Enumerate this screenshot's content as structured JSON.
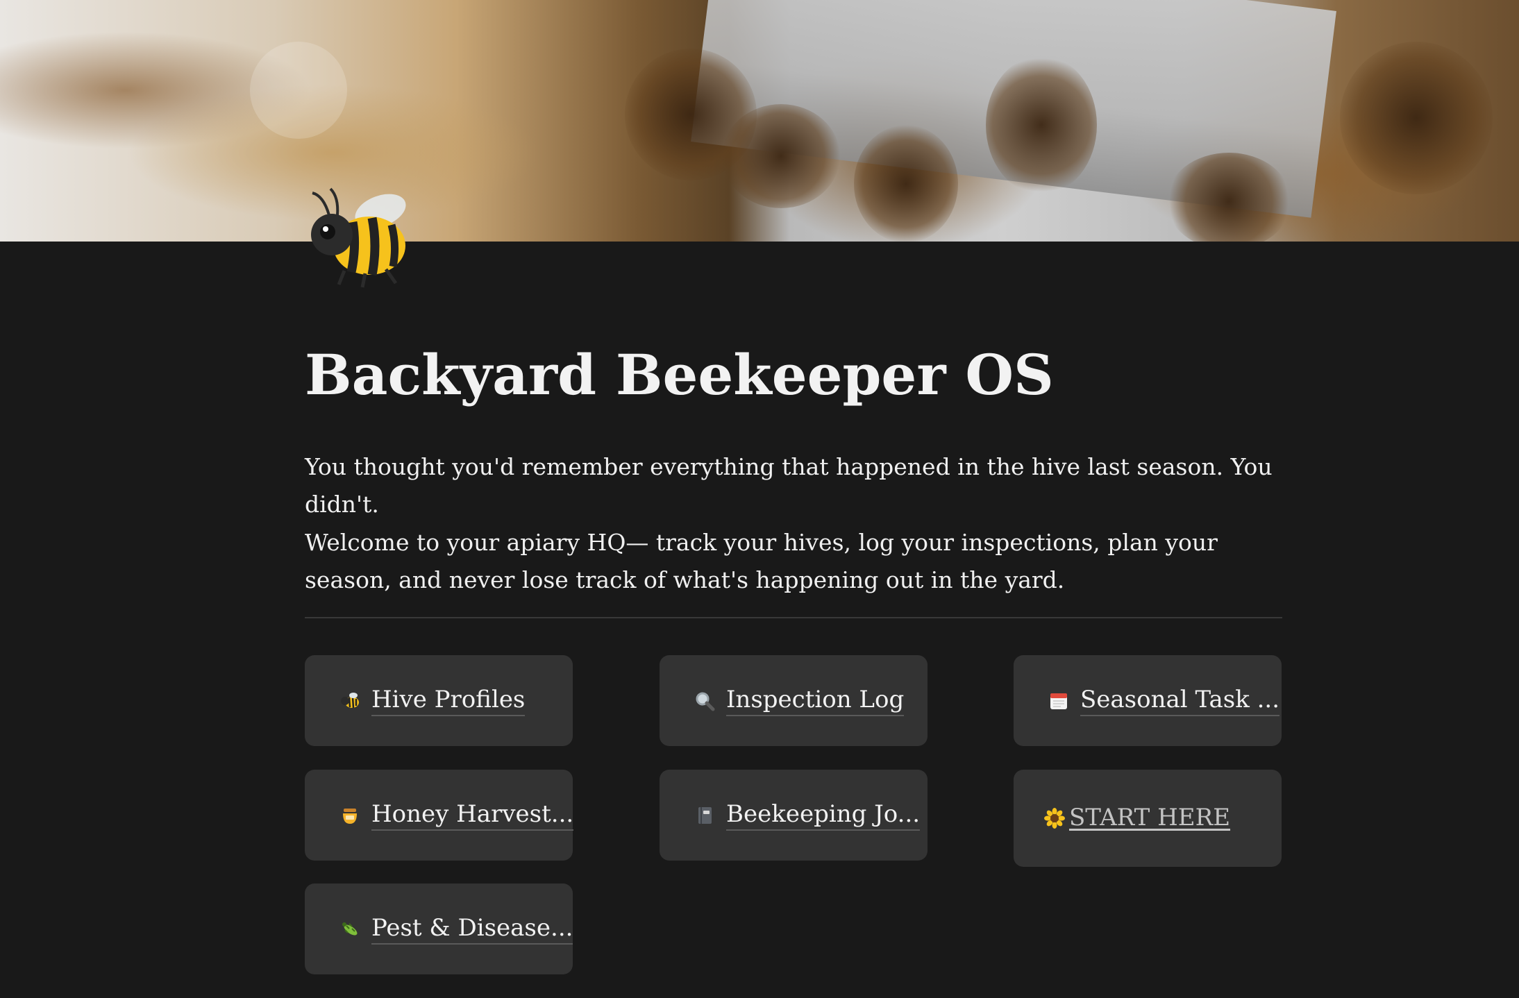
{
  "page": {
    "title": "Backyard Beekeeper OS",
    "intro": "You thought you'd remember everything that happened in the hive last season. You didn't.",
    "welcome": "Welcome to your apiary HQ— track your hives, log your inspections, plan your season, and never lose track of what's happening out in the yard.",
    "icon": "bee-emoji",
    "cover": "honeybees-at-hive-entrance-photo"
  },
  "links": [
    {
      "label": "Hive Profiles",
      "icon": "bee-icon"
    },
    {
      "label": "Inspection Log",
      "icon": "magnifier-icon"
    },
    {
      "label": "Seasonal Task ...",
      "icon": "calendar-icon"
    },
    {
      "label": "Honey Harvest...",
      "icon": "honey-pot-icon"
    },
    {
      "label": "Beekeeping Jo...",
      "icon": "notebook-icon"
    },
    {
      "label": "START HERE",
      "icon": "sunflower-icon"
    },
    {
      "label": "Pest & Disease...",
      "icon": "bug-icon"
    }
  ],
  "colors": {
    "background": "#191919",
    "card": "#333333",
    "text": "#f2f2f2",
    "divider": "#383838"
  }
}
